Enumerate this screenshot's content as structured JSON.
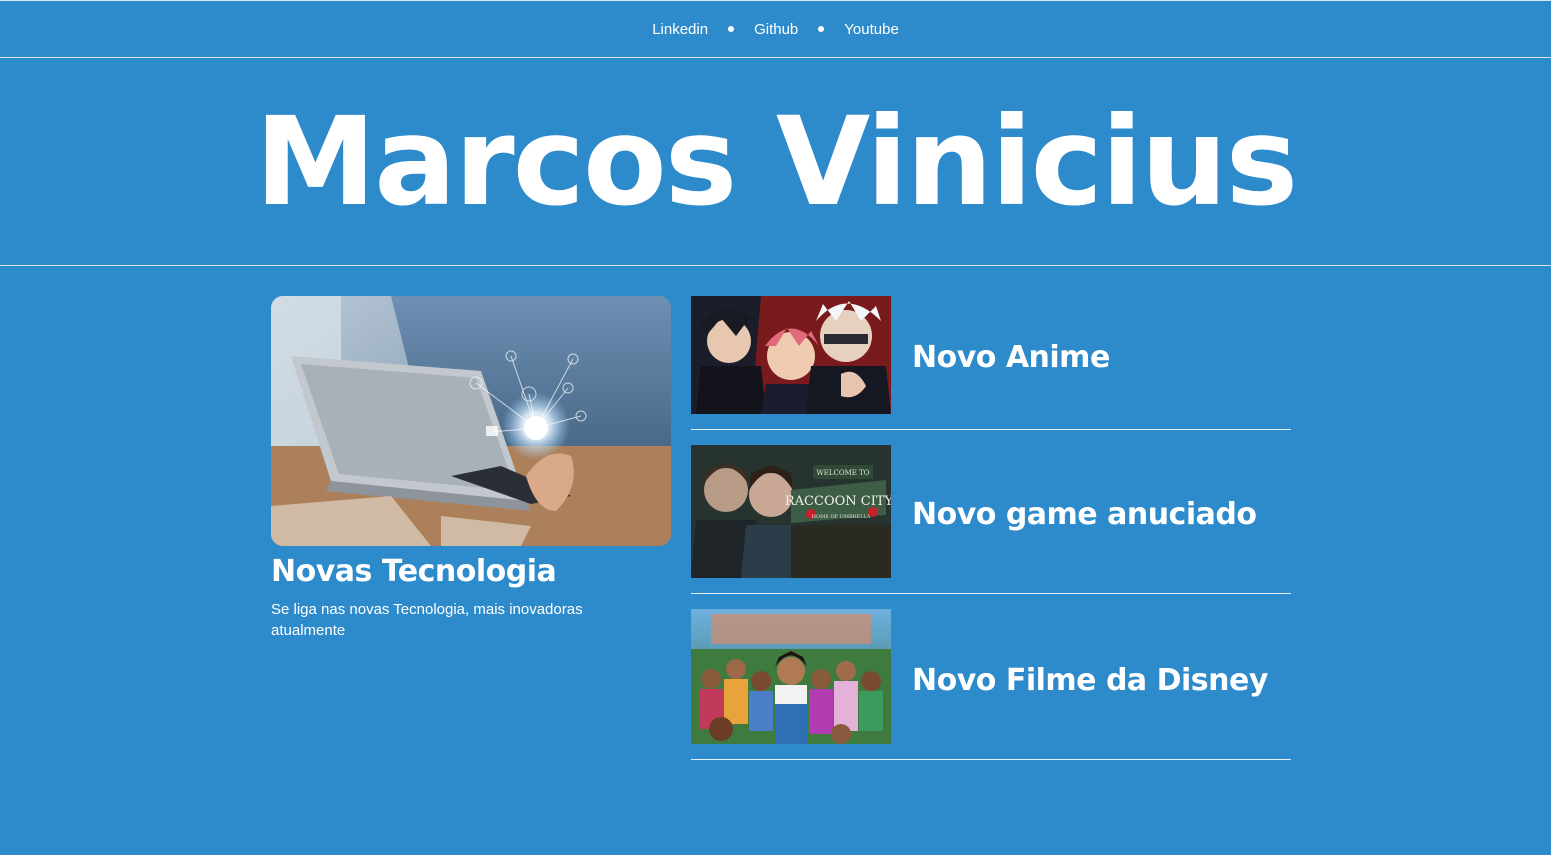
{
  "nav": {
    "links": [
      "Linkedin",
      "Github",
      "Youtube"
    ]
  },
  "hero": {
    "title": "Marcos Vinicius"
  },
  "feature": {
    "title": "Novas Tecnologia",
    "description": "Se liga nas novas Tecnologia, mais inovadoras atualmente",
    "image": "laptop-technology-image"
  },
  "news": [
    {
      "title": "Novo Anime",
      "image": "anime-characters-image"
    },
    {
      "title": "Novo game anuciado",
      "image": "raccoon-city-game-image"
    },
    {
      "title": "Novo Filme da Disney",
      "image": "disney-movie-image"
    }
  ],
  "colors": {
    "background": "#2e8bcb",
    "text": "#ffffff",
    "divider": "#d7e6f2"
  }
}
